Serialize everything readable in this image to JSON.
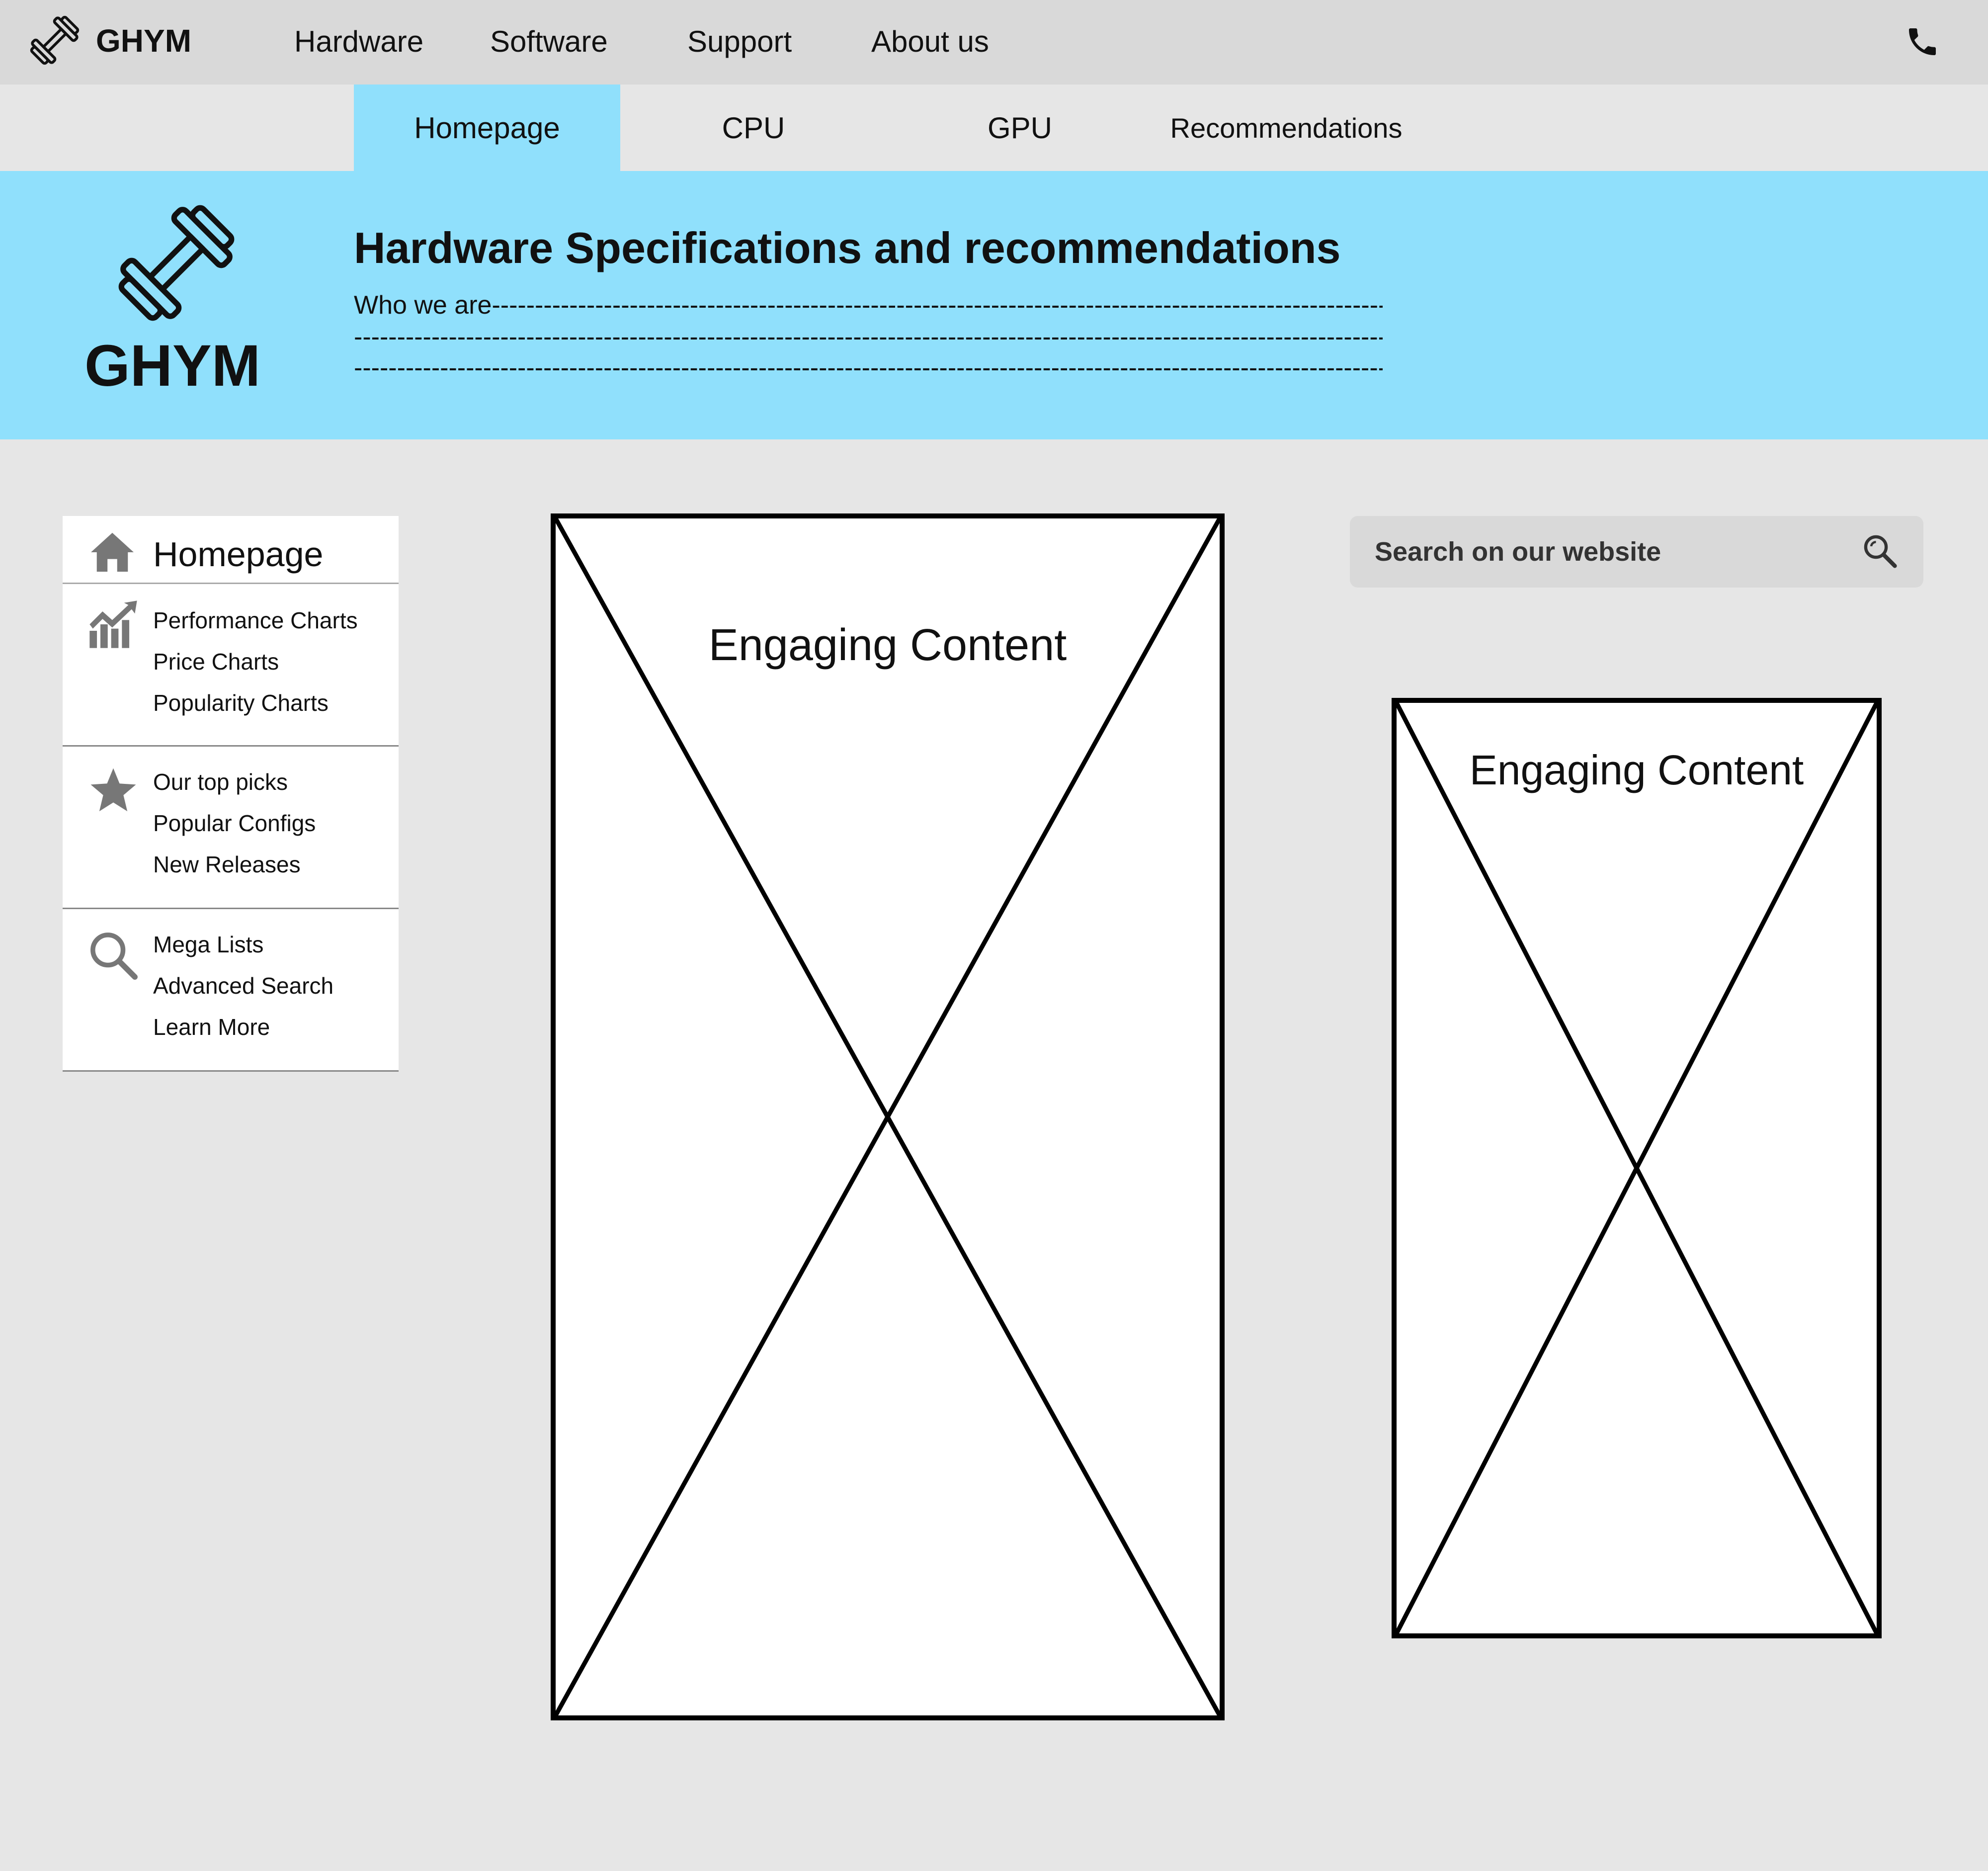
{
  "topnav": {
    "brand": "GHYM",
    "items": [
      "Hardware",
      "Software",
      "Support",
      "About us"
    ],
    "logo_icon": "dumbbell-icon",
    "phone_icon": "phone-icon"
  },
  "subtabs": {
    "items": [
      "Homepage",
      "CPU",
      "GPU",
      "Recommendations"
    ],
    "active": "Homepage"
  },
  "hero": {
    "brand": "GHYM",
    "title": "Hardware Specifications and recommendations",
    "lines": [
      "Who we are-----------------------------------------------------------------------------------------------------------------------",
      "--------------------------------------------------------------------------------------------------------------------------------------",
      "--------------------------------------------------------------------------------------------------------------------------------------"
    ],
    "logo_icon": "dumbbell-icon"
  },
  "sidemenu": {
    "head": {
      "label": "Homepage",
      "icon": "home-icon"
    },
    "groups": [
      {
        "icon": "chart-icon",
        "items": [
          "Performance Charts",
          "Price Charts",
          "Popularity Charts"
        ]
      },
      {
        "icon": "star-icon",
        "items": [
          "Our top picks",
          "Popular Configs",
          "New Releases"
        ]
      },
      {
        "icon": "search-icon",
        "items": [
          "Mega Lists",
          "Advanced Search",
          "Learn More"
        ]
      }
    ]
  },
  "content": {
    "main_label": "Engaging Content",
    "side_label": "Engaging Content"
  },
  "search": {
    "placeholder": "Search on our website",
    "icon": "search-icon"
  },
  "colors": {
    "accent": "#90e0fc",
    "topbar": "#d9d9d9",
    "background": "#e6e6e6",
    "icon_gray": "#777777"
  }
}
